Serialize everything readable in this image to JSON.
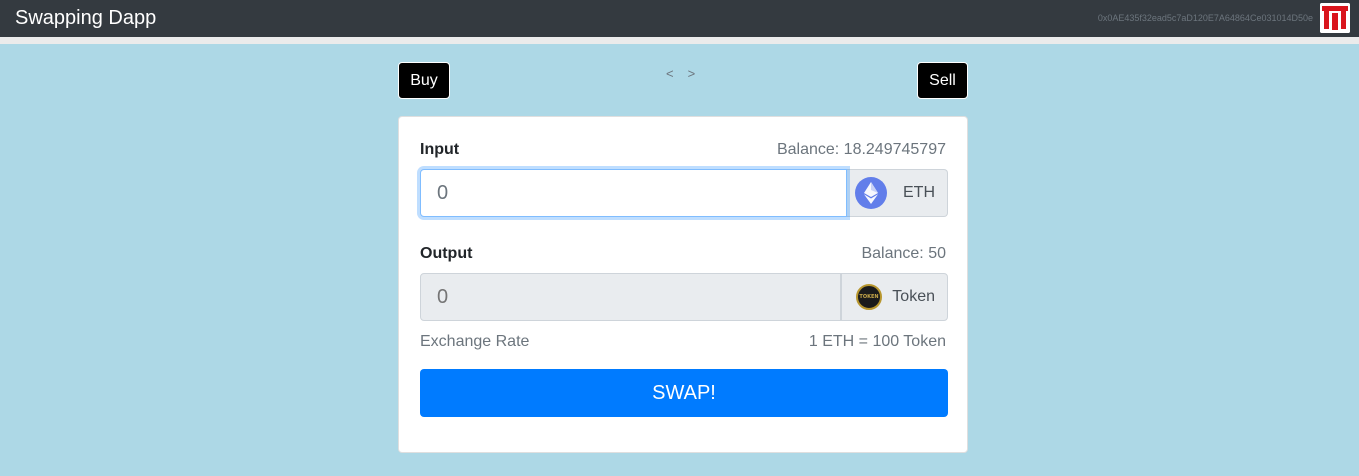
{
  "navbar": {
    "brand": "Swapping Dapp",
    "account": "0x0AE435f32ead5c7aD120E7A64864Ce031014D50e"
  },
  "toggle": {
    "buy_label": "Buy",
    "sell_label": "Sell",
    "prev_arrow": "<",
    "next_arrow": ">"
  },
  "form": {
    "input": {
      "label": "Input",
      "balance": "Balance: 18.249745797",
      "placeholder": "0",
      "currency": "ETH",
      "icon": "ethereum-icon"
    },
    "output": {
      "label": "Output",
      "balance": "Balance: 50",
      "placeholder": "0",
      "currency": "Token",
      "icon": "token-icon"
    },
    "exchange_rate_label": "Exchange Rate",
    "exchange_rate_value": "1 ETH = 100 Token",
    "swap_label": "SWAP!"
  },
  "colors": {
    "background": "#add8e6",
    "navbar": "#343a40",
    "primary": "#007bff",
    "eth": "#627eea"
  }
}
